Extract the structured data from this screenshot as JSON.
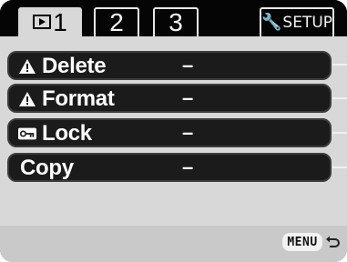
{
  "tabs": {
    "tab1_label": "1",
    "tab2_label": "2",
    "tab3_label": "3",
    "setup_label": "SETUP",
    "active": "1"
  },
  "menu": {
    "rows": [
      {
        "label": "Delete",
        "value": "–",
        "icon": "warning-icon"
      },
      {
        "label": "Format",
        "value": "–",
        "icon": "warning-icon"
      },
      {
        "label": "Lock",
        "value": "–",
        "icon": "key-icon"
      },
      {
        "label": "Copy",
        "value": "–",
        "icon": null
      }
    ]
  },
  "footer": {
    "menu_label": "MENU",
    "return_icon": "return-arrow-icon"
  },
  "colors": {
    "panel_bg": "#d8d8d8",
    "row_bg": "#1b1b1b",
    "tab_active_bg": "#d8d8d8",
    "text_light": "#ffffff"
  }
}
